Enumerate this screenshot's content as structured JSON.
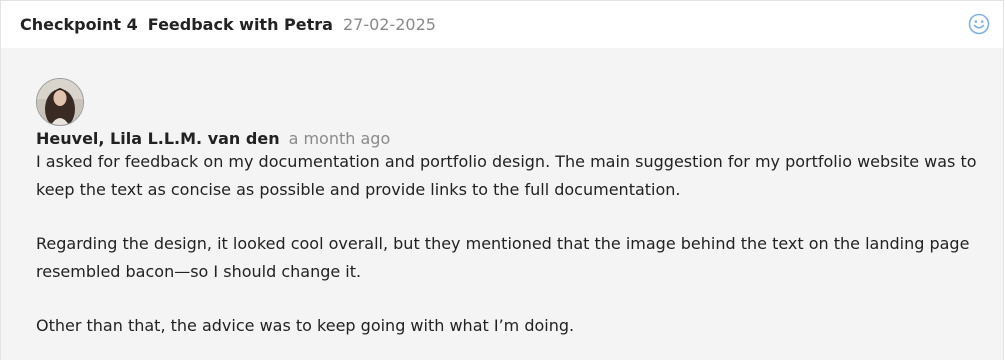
{
  "header": {
    "checkpoint_label": "Checkpoint 4",
    "title": "Feedback with Petra",
    "date": "27-02-2025",
    "reaction_icon": "smiley-icon"
  },
  "comment": {
    "author": "Heuvel, Lila L.L.M. van den",
    "time_ago": "a month ago",
    "paragraphs": [
      "I asked for feedback on my documentation and portfolio design. The main suggestion for my portfolio website was to keep the text as concise as possible and provide links to the full documentation.",
      "Regarding the design, it looked cool overall, but they mentioned that the image behind the text on the landing page resembled bacon—so I should change it.",
      "Other than that, the advice was to keep going with what I’m doing."
    ]
  },
  "colors": {
    "accent": "#4a90e2",
    "muted_text": "#8a8a8a",
    "body_bg": "#f4f4f4"
  }
}
